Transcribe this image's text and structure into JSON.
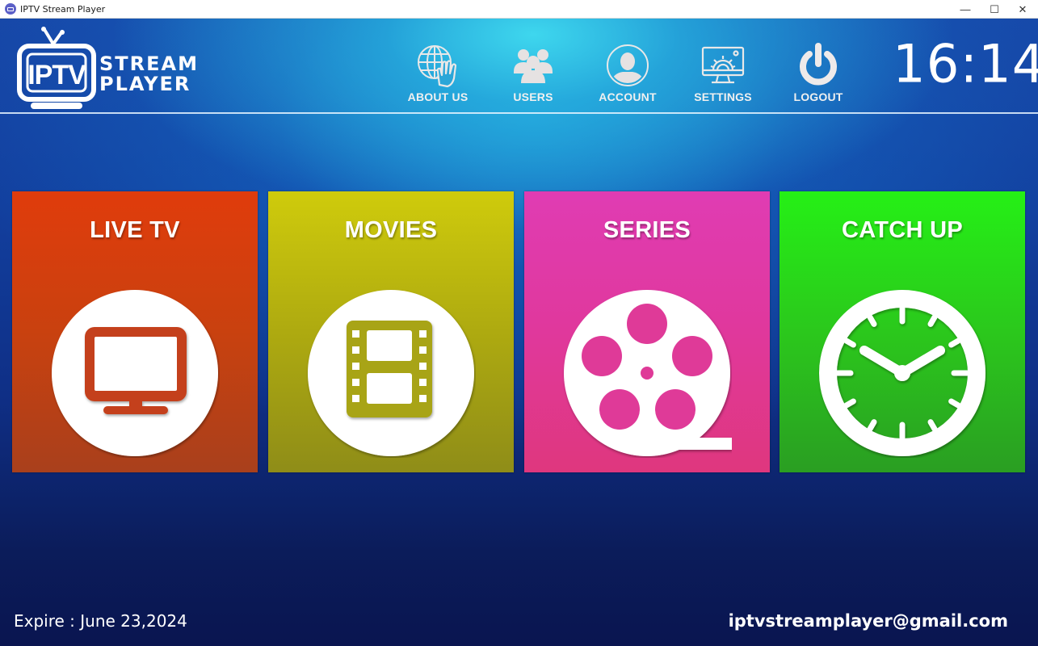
{
  "window": {
    "title": "IPTV Stream Player",
    "controls": {
      "minimize": "—",
      "maximize": "☐",
      "close": "✕"
    }
  },
  "logo": {
    "badge_text": "IPTV",
    "line1": "STREAM",
    "line2": "PLAYER"
  },
  "nav": [
    {
      "label": "ABOUT US",
      "icon": "globe-hand-icon"
    },
    {
      "label": "USERS",
      "icon": "users-icon"
    },
    {
      "label": "ACCOUNT",
      "icon": "account-icon"
    },
    {
      "label": "SETTINGS",
      "icon": "monitor-gear-icon"
    },
    {
      "label": "LOGOUT",
      "icon": "power-icon"
    }
  ],
  "clock": "16:14",
  "tiles": [
    {
      "title": "LIVE TV",
      "icon": "tv-icon",
      "color": "#d8400f"
    },
    {
      "title": "MOVIES",
      "icon": "film-strip-icon",
      "color": "#bcb80e"
    },
    {
      "title": "SERIES",
      "icon": "film-reel-icon",
      "color": "#e03a9c"
    },
    {
      "title": "CATCH UP",
      "icon": "clock-icon",
      "color": "#2bd31a"
    }
  ],
  "footer": {
    "expire": "Expire : June 23,2024",
    "email": "iptvstreamplayer@gmail.com"
  }
}
